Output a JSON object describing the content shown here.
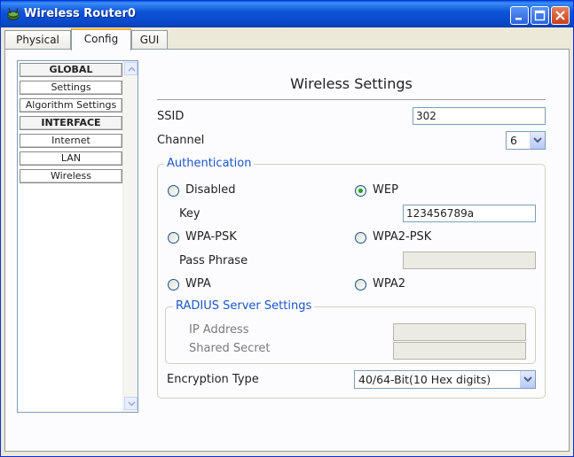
{
  "window": {
    "title": "Wireless Router0"
  },
  "tabs": [
    {
      "label": "Physical"
    },
    {
      "label": "Config"
    },
    {
      "label": "GUI"
    }
  ],
  "sidebar": {
    "items": [
      {
        "label": "GLOBAL",
        "type": "header"
      },
      {
        "label": "Settings",
        "type": "item"
      },
      {
        "label": "Algorithm Settings",
        "type": "item"
      },
      {
        "label": "INTERFACE",
        "type": "header"
      },
      {
        "label": "Internet",
        "type": "item"
      },
      {
        "label": "LAN",
        "type": "item"
      },
      {
        "label": "Wireless",
        "type": "item"
      }
    ]
  },
  "main": {
    "title": "Wireless Settings",
    "ssid": {
      "label": "SSID",
      "value": "302"
    },
    "channel": {
      "label": "Channel",
      "value": "6"
    },
    "authentication": {
      "legend": "Authentication",
      "options": {
        "disabled": {
          "label": "Disabled",
          "checked": false
        },
        "wep": {
          "label": "WEP",
          "checked": true
        },
        "wpa_psk": {
          "label": "WPA-PSK",
          "checked": false
        },
        "wpa2_psk": {
          "label": "WPA2-PSK",
          "checked": false
        },
        "wpa": {
          "label": "WPA",
          "checked": false
        },
        "wpa2": {
          "label": "WPA2",
          "checked": false
        }
      },
      "key": {
        "label": "Key",
        "value": "123456789a"
      },
      "pass_phrase": {
        "label": "Pass Phrase",
        "value": ""
      },
      "radius": {
        "legend": "RADIUS Server Settings",
        "ip_address": {
          "label": "IP Address",
          "value": ""
        },
        "shared_secret": {
          "label": "Shared Secret",
          "value": ""
        }
      },
      "encryption": {
        "label": "Encryption Type",
        "value": "40/64-Bit(10 Hex digits)"
      }
    }
  },
  "colors": {
    "titlebar": "#0846c6",
    "legend": "#1a56c9",
    "radio_dot": "#21a121",
    "tab_accent": "#f7b030"
  },
  "icons": [
    "router-icon",
    "minimize-icon",
    "maximize-icon",
    "close-icon",
    "chevron-down-icon",
    "scroll-up-icon",
    "scroll-down-icon"
  ]
}
